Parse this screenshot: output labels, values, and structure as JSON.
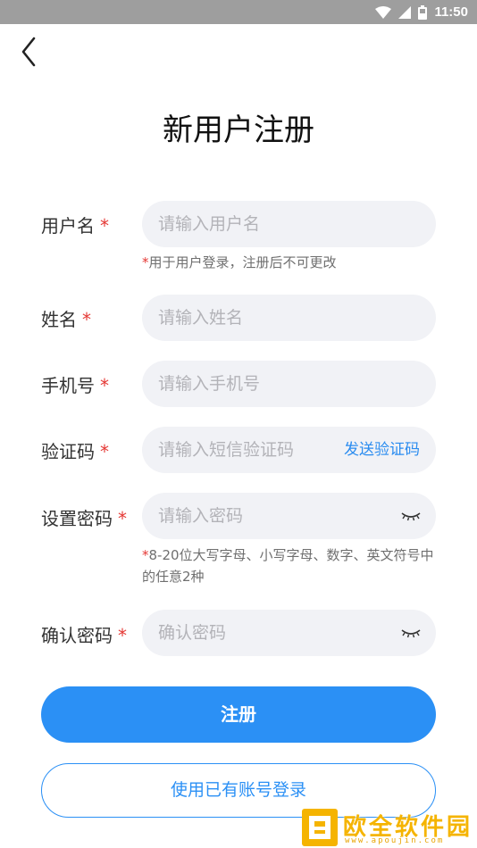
{
  "status_bar": {
    "time": "11:50",
    "icons": [
      "wifi-icon",
      "signal-icon",
      "battery-icon"
    ]
  },
  "header": {
    "title": "新用户注册",
    "back_icon": "chevron-left-icon"
  },
  "form": {
    "required_mark": "*",
    "username": {
      "label": "用户名",
      "placeholder": "请输入用户名",
      "hint": "用于用户登录，注册后不可更改"
    },
    "realname": {
      "label": "姓名",
      "placeholder": "请输入姓名"
    },
    "phone": {
      "label": "手机号",
      "placeholder": "请输入手机号"
    },
    "code": {
      "label": "验证码",
      "placeholder": "请输入短信验证码",
      "send_label": "发送验证码"
    },
    "password": {
      "label": "设置密码",
      "placeholder": "请输入密码",
      "hint": "8-20位大写字母、小写字母、数字、英文符号中的任意2种",
      "eye_icon": "eye-closed-icon"
    },
    "confirm": {
      "label": "确认密码",
      "placeholder": "确认密码",
      "eye_icon": "eye-closed-icon"
    }
  },
  "actions": {
    "register_label": "注册",
    "login_label": "使用已有账号登录"
  },
  "watermark": {
    "name": "欧全软件园",
    "url": "www.apoujin.com"
  },
  "colors": {
    "accent": "#2b90f5",
    "required": "#e53935",
    "field_bg": "#f1f2f6",
    "status_bar": "#9e9e9e"
  }
}
